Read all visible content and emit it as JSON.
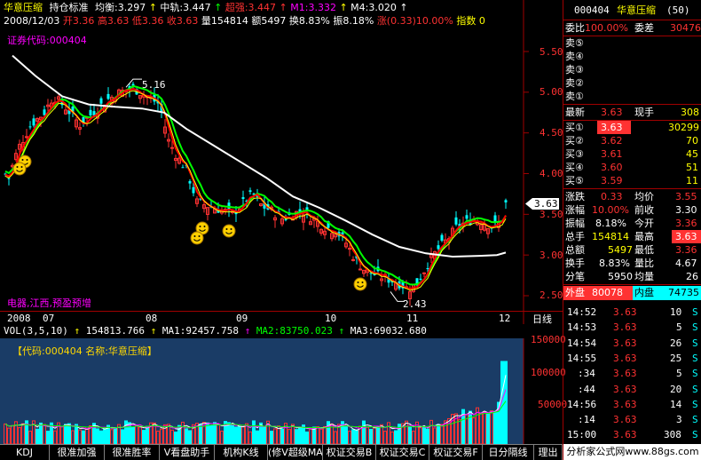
{
  "header": {
    "stock_name": "华意压缩",
    "indicator_name": "持仓标准",
    "avg_label": "均衡:3.297",
    "mid_rail_label": "中轨:3.447",
    "super_strong_label": "超强:3.447",
    "m1_label": "M1:3.332",
    "m4_label": "M4:3.020",
    "date_label": "2008/12/03",
    "open_label": "开3.36",
    "high_label": "高3.63",
    "low_label": "低3.36",
    "close_label": "收3.63",
    "volume_label": "量154814",
    "amount_label": "额5497",
    "turnover_label": "换8.83%",
    "amplitude_label": "振8.18%",
    "change_label": "涨(0.33)10.00%",
    "index_label": "指数 0",
    "code_tag": "证券代码:000404",
    "concept_tag": "电器,江西,预盈预增"
  },
  "price_axis": {
    "ticks": [
      "5.50",
      "5.00",
      "4.50",
      "4.00",
      "3.50",
      "3.00",
      "2.50"
    ],
    "current_price": "3.63",
    "high_marker": "5.16",
    "low_marker": "2.43"
  },
  "time_axis": {
    "labels": [
      "2008",
      "07",
      "08",
      "09",
      "10",
      "11",
      "12"
    ],
    "period": "日线"
  },
  "volume_panel": {
    "header_prefix": "VOL(3,5,10)",
    "vol_value": "154813.766",
    "ma1": "MA1:92457.758",
    "ma2": "MA2:83750.023",
    "ma3": "MA3:69032.680",
    "info": "【代码:000404 名称:华意压缩】",
    "axis_ticks": [
      "150000",
      "100000",
      "50000"
    ]
  },
  "quote": {
    "code": "000404",
    "name": "华意压缩",
    "count": "(50)",
    "weibi_label": "委比",
    "weibi_value": "100.00%",
    "weicha_label": "委差",
    "weicha_value": "30476",
    "sells": [
      {
        "label": "卖⑤",
        "price": "",
        "vol": ""
      },
      {
        "label": "卖④",
        "price": "",
        "vol": ""
      },
      {
        "label": "卖③",
        "price": "",
        "vol": ""
      },
      {
        "label": "卖②",
        "price": "",
        "vol": ""
      },
      {
        "label": "卖①",
        "price": "",
        "vol": ""
      }
    ],
    "latest_label": "最新",
    "latest_value": "3.63",
    "xianshou_label": "现手",
    "xianshou_value": "308",
    "buys": [
      {
        "label": "买①",
        "price": "3.63",
        "vol": "30299"
      },
      {
        "label": "买②",
        "price": "3.62",
        "vol": "70"
      },
      {
        "label": "买③",
        "price": "3.61",
        "vol": "45"
      },
      {
        "label": "买④",
        "price": "3.60",
        "vol": "51"
      },
      {
        "label": "买⑤",
        "price": "3.59",
        "vol": "11"
      }
    ],
    "stats": [
      {
        "l1": "涨跌",
        "v1": "0.33",
        "l2": "均价",
        "v2": "3.55"
      },
      {
        "l1": "涨幅",
        "v1": "10.00%",
        "l2": "前收",
        "v2": "3.30"
      },
      {
        "l1": "振幅",
        "v1": "8.18%",
        "l2": "今开",
        "v2": "3.36"
      },
      {
        "l1": "总手",
        "v1": "154814",
        "l2": "最高",
        "v2": "3.63"
      },
      {
        "l1": "总额",
        "v1": "5497",
        "l2": "最低",
        "v2": "3.36"
      },
      {
        "l1": "换手",
        "v1": "8.83%",
        "l2": "量比",
        "v2": "4.67"
      },
      {
        "l1": "分笔",
        "v1": "5950",
        "l2": "均量",
        "v2": "26"
      }
    ],
    "outer_label": "外盘",
    "outer_value": "80078",
    "inner_label": "内盘",
    "inner_value": "74735",
    "ticks": [
      {
        "time": "14:52",
        "price": "3.63",
        "vol": "10",
        "side": "S"
      },
      {
        "time": "14:53",
        "price": "3.63",
        "vol": "5",
        "side": "S"
      },
      {
        "time": "14:54",
        "price": "3.63",
        "vol": "26",
        "side": "S"
      },
      {
        "time": "14:55",
        "price": "3.63",
        "vol": "25",
        "side": "S"
      },
      {
        "time": ":34",
        "price": "3.63",
        "vol": "5",
        "side": "S"
      },
      {
        "time": ":44",
        "price": "3.63",
        "vol": "20",
        "side": "S"
      },
      {
        "time": "14:56",
        "price": "3.63",
        "vol": "14",
        "side": "S"
      },
      {
        "time": ":14",
        "price": "3.63",
        "vol": "3",
        "side": "S"
      },
      {
        "time": "15:00",
        "price": "3.63",
        "vol": "308",
        "side": "S"
      }
    ]
  },
  "tabs": [
    "KDJ",
    "很准加强",
    "很准胜率",
    "V看盘助手",
    "机构K线",
    "(修V超级MACD",
    "权证交易B",
    "权证交易C",
    "权证交易F",
    "日分隔线",
    "理出"
  ],
  "watermark": "分析家公式网www.88gs.com",
  "colors": {
    "up": "#ff3232",
    "down": "#00ffff",
    "ma_white": "#ffffff",
    "ma_green": "#00ff00",
    "ma_red": "#ff0000",
    "ma_yellow": "#ffff00",
    "volume_bg": "#1a3c66"
  }
}
